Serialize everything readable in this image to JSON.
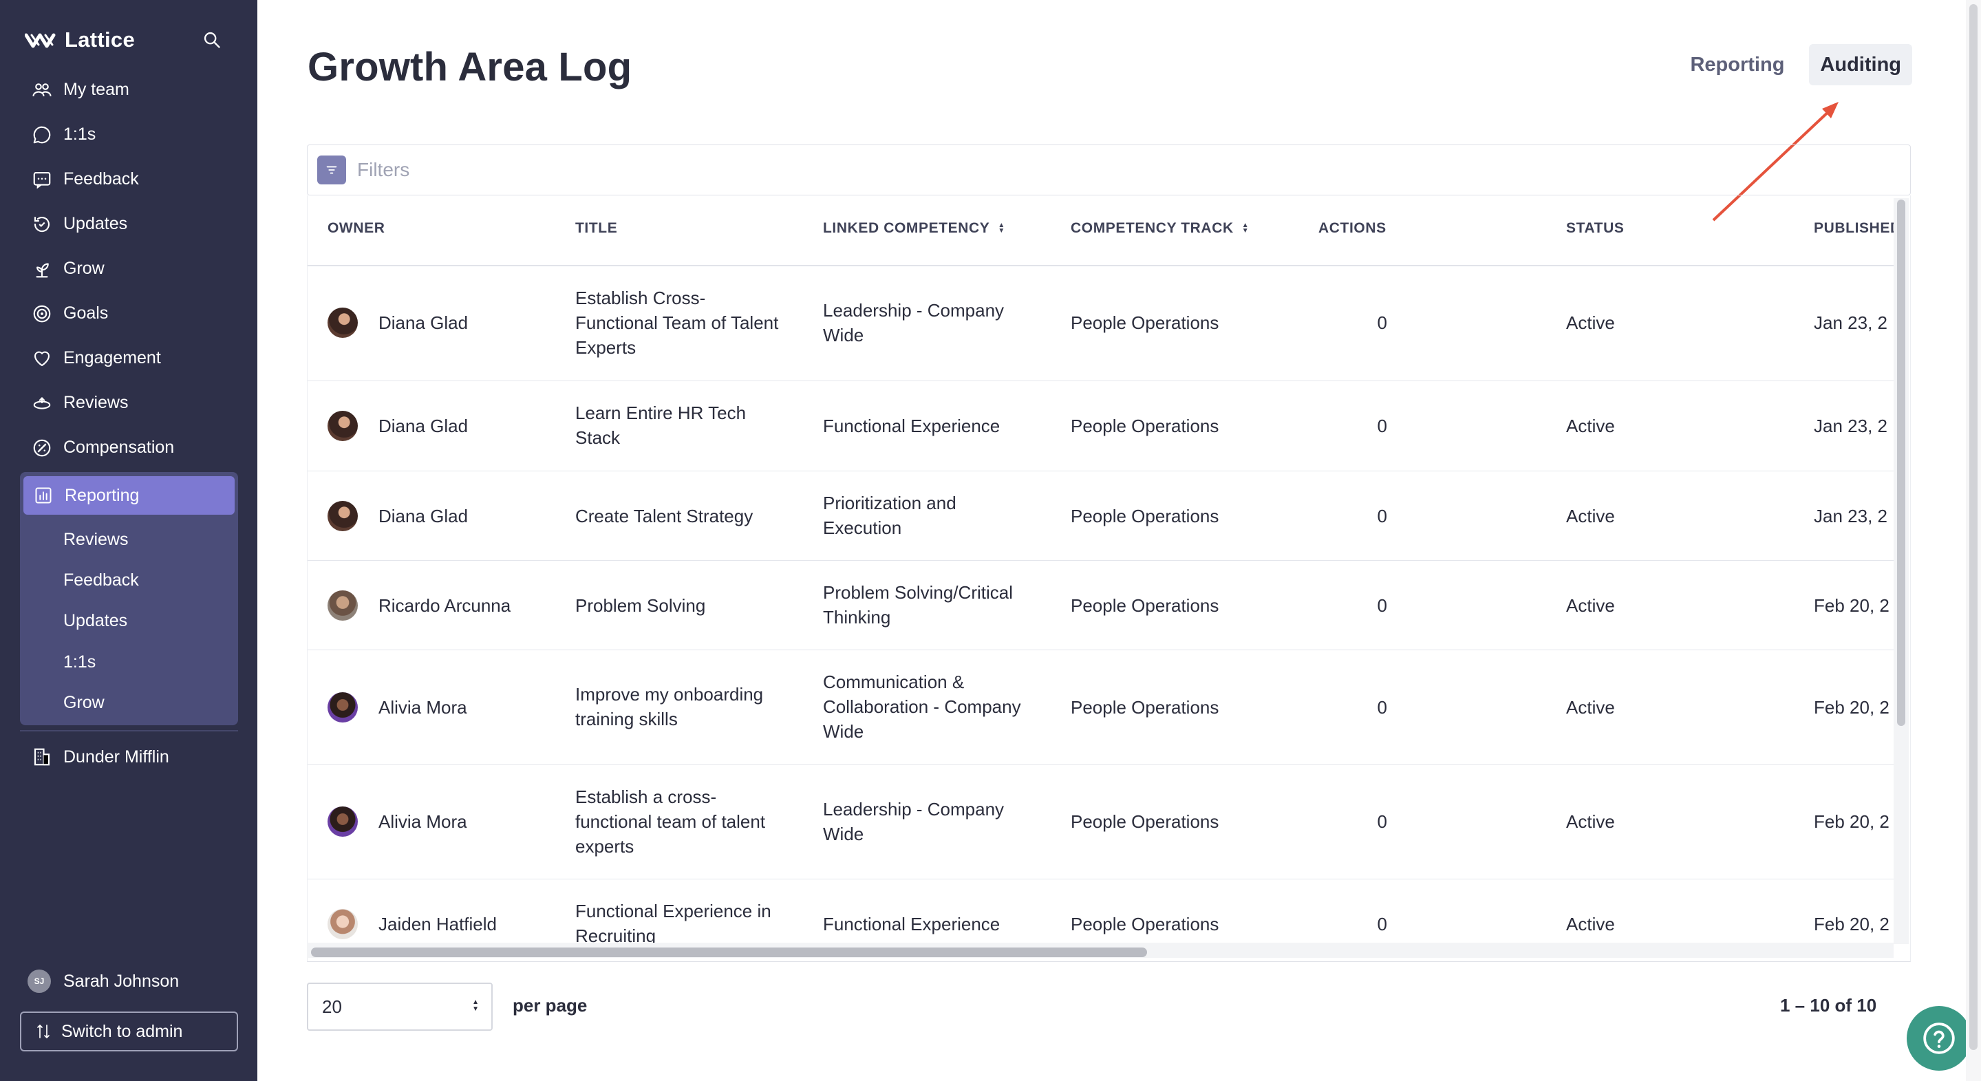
{
  "brand": {
    "name": "Lattice"
  },
  "sidebar": {
    "items": [
      {
        "label": "My team",
        "icon": "team-icon"
      },
      {
        "label": "1:1s",
        "icon": "chat-bubble-icon"
      },
      {
        "label": "Feedback",
        "icon": "feedback-icon"
      },
      {
        "label": "Updates",
        "icon": "updates-icon"
      },
      {
        "label": "Grow",
        "icon": "grow-icon"
      },
      {
        "label": "Goals",
        "icon": "target-icon"
      },
      {
        "label": "Engagement",
        "icon": "heart-icon"
      },
      {
        "label": "Reviews",
        "icon": "reviews-icon"
      },
      {
        "label": "Compensation",
        "icon": "compensation-icon"
      }
    ],
    "reporting": {
      "label": "Reporting",
      "sub_items": [
        "Reviews",
        "Feedback",
        "Updates",
        "1:1s",
        "Grow"
      ]
    },
    "org": "Dunder Mifflin",
    "user": {
      "initials": "SJ",
      "name": "Sarah Johnson"
    },
    "switch_admin": "Switch to admin"
  },
  "page": {
    "title": "Growth Area Log",
    "tabs": [
      {
        "label": "Reporting",
        "active": false
      },
      {
        "label": "Auditing",
        "active": true
      }
    ],
    "filters_placeholder": "Filters"
  },
  "table": {
    "columns": [
      "OWNER",
      "TITLE",
      "LINKED COMPETENCY",
      "COMPETENCY TRACK",
      "ACTIONS",
      "STATUS",
      "PUBLISHED"
    ],
    "rows": [
      {
        "owner": "Diana Glad",
        "title": "Establish Cross-Functional Team of Talent Experts",
        "competency": "Leadership - Company Wide",
        "track": "People Operations",
        "actions": "0",
        "status": "Active",
        "published": "Jan 23, 2"
      },
      {
        "owner": "Diana Glad",
        "title": "Learn Entire HR Tech Stack",
        "competency": "Functional Experience",
        "track": "People Operations",
        "actions": "0",
        "status": "Active",
        "published": "Jan 23, 2"
      },
      {
        "owner": "Diana Glad",
        "title": "Create Talent Strategy",
        "competency": "Prioritization and Execution",
        "track": "People Operations",
        "actions": "0",
        "status": "Active",
        "published": "Jan 23, 2"
      },
      {
        "owner": "Ricardo Arcunna",
        "title": "Problem Solving",
        "competency": "Problem Solving/Critical Thinking",
        "track": "People Operations",
        "actions": "0",
        "status": "Active",
        "published": "Feb 20, 2"
      },
      {
        "owner": "Alivia Mora",
        "title": "Improve my onboarding training skills",
        "competency": "Communication & Collaboration - Company Wide",
        "track": "People Operations",
        "actions": "0",
        "status": "Active",
        "published": "Feb 20, 2"
      },
      {
        "owner": "Alivia Mora",
        "title": "Establish a cross-functional team of talent experts",
        "competency": "Leadership - Company Wide",
        "track": "People Operations",
        "actions": "0",
        "status": "Active",
        "published": "Feb 20, 2"
      },
      {
        "owner": "Jaiden Hatfield",
        "title": "Functional Experience in Recruiting",
        "competency": "Functional Experience",
        "track": "People Operations",
        "actions": "0",
        "status": "Active",
        "published": "Feb 20, 2"
      }
    ]
  },
  "pagination": {
    "per_page_value": "20",
    "per_page_label": "per page",
    "range": "1 – 10 of 10"
  },
  "colors": {
    "sidebar_bg": "#2e3049",
    "reporting_group": "#4b4d79",
    "reporting_active": "#7d79d2",
    "help": "#3b9a86",
    "arrow": "#e5533c"
  }
}
